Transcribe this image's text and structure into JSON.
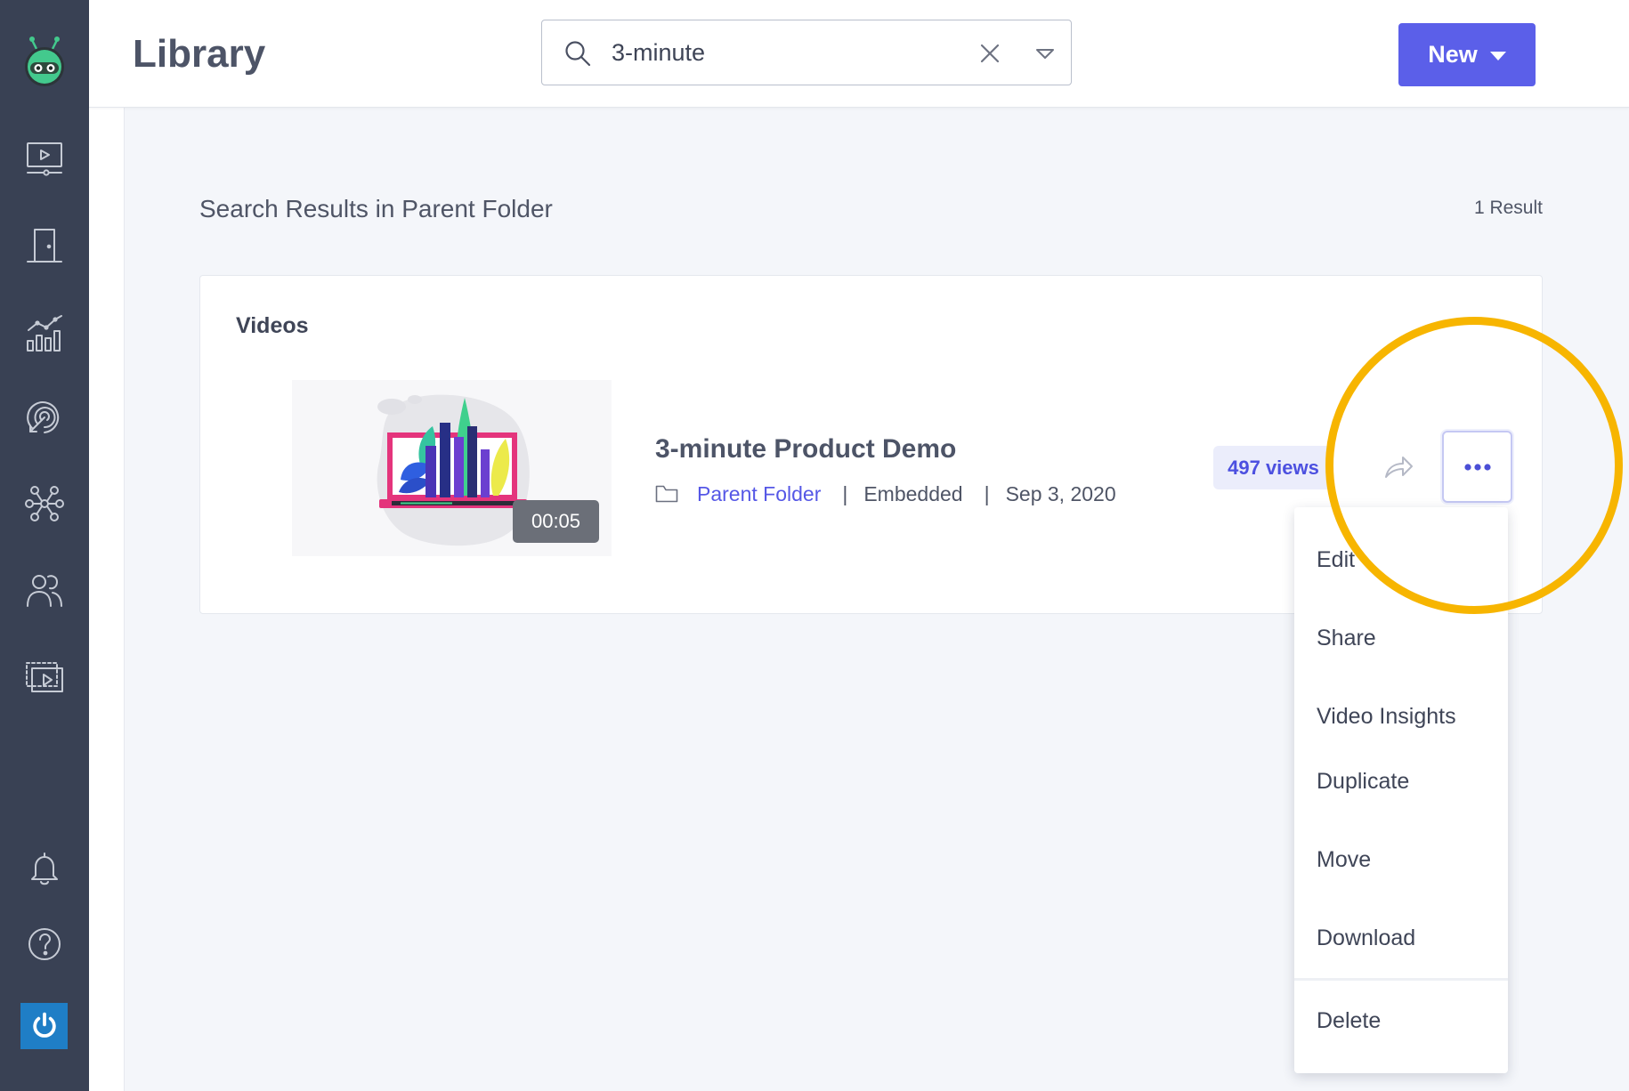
{
  "app": {
    "logo_icon": "robot-logo-icon"
  },
  "sidebar": {
    "items": [
      {
        "icon": "video-monitor-icon"
      },
      {
        "icon": "door-icon"
      },
      {
        "icon": "analytics-chart-icon"
      },
      {
        "icon": "target-icon"
      },
      {
        "icon": "network-nodes-icon"
      },
      {
        "icon": "people-icon"
      },
      {
        "icon": "video-library-icon"
      }
    ],
    "bottom_items": [
      {
        "icon": "bell-icon"
      },
      {
        "icon": "help-icon"
      },
      {
        "icon": "power-icon"
      }
    ]
  },
  "header": {
    "title": "Library",
    "search": {
      "value": "3-minute",
      "icons": [
        "search-icon",
        "clear-icon",
        "filter-caret-icon"
      ]
    },
    "new_button": {
      "label": "New",
      "icon": "caret-down-icon"
    }
  },
  "results": {
    "heading": "Search Results in Parent Folder",
    "count": "1 Result"
  },
  "videos_section": {
    "title": "Videos",
    "items": [
      {
        "title": "3-minute Product Demo",
        "duration": "00:05",
        "folder": "Parent Folder",
        "separator": "|",
        "embed_status": "Embedded",
        "date": "Sep 3, 2020",
        "views": "497 views",
        "actions": {
          "share_icon": "share-arrow-icon",
          "more_icon": "more-dots-icon"
        }
      }
    ]
  },
  "action_menu": {
    "items": [
      "Edit",
      "Share",
      "Video Insights",
      "Duplicate",
      "Move",
      "Download"
    ],
    "danger_item": "Delete"
  },
  "colors": {
    "sidebar": "#394154",
    "accent": "#5b5fe9",
    "link": "#5557e6",
    "views_badge_bg": "#ebedfb",
    "highlight_ring": "#f7b500",
    "page_bg": "#f4f6fa"
  }
}
